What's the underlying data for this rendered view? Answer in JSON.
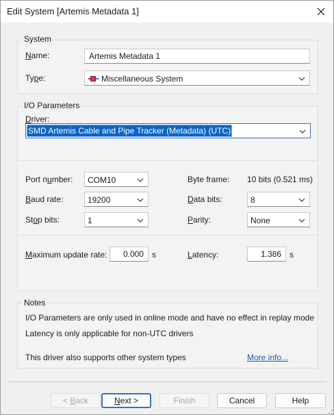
{
  "window": {
    "title": "Edit System [Artemis Metadata 1]"
  },
  "system": {
    "group_title": "System",
    "name_label": "Name:",
    "name_value": "Artemis Metadata 1",
    "type_label": "Type:",
    "type_value": "Miscellaneous System"
  },
  "io": {
    "group_title": "I/O Parameters",
    "driver_label": "Driver:",
    "driver_value": "SMD Artemis Cable and Pipe Tracker (Metadata) (UTC)",
    "port_label": "Port number:",
    "port_value": "COM10",
    "baud_label": "Baud rate:",
    "baud_value": "19200",
    "stop_label": "Stop bits:",
    "stop_value": "1",
    "byteframe_label": "Byte frame:",
    "byteframe_value": "10 bits (0.521 ms)",
    "databits_label": "Data bits:",
    "databits_value": "8",
    "parity_label": "Parity:",
    "parity_value": "None",
    "maxrate_label": "Maximum update rate:",
    "maxrate_value": "0.000",
    "maxrate_unit": "s",
    "latency_label": "Latency:",
    "latency_value": "1.386",
    "latency_unit": "s"
  },
  "notes": {
    "group_title": "Notes",
    "line1": "I/O Parameters are only used in online mode and have no effect in replay mode",
    "line2": "Latency is only applicable for non-UTC drivers",
    "line3": "This driver also supports other system types",
    "more_info": "More info..."
  },
  "buttons": {
    "back": "< Back",
    "next": "Next >",
    "finish": "Finish",
    "cancel": "Cancel",
    "help": "Help"
  },
  "colors": {
    "accent": "#0a64c8",
    "link": "#1a55b3",
    "window_bg": "#f0f0f0"
  }
}
